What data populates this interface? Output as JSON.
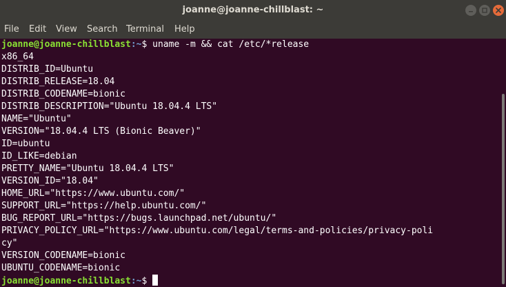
{
  "window": {
    "title": "joanne@joanne-chillblast: ~"
  },
  "menu": [
    "File",
    "Edit",
    "View",
    "Search",
    "Terminal",
    "Help"
  ],
  "prompt": {
    "user_host": "joanne@joanne-chillblast",
    "path": ":~",
    "symbol": "$ "
  },
  "terminal": {
    "command": "uname -m && cat /etc/*release",
    "output": [
      "x86_64",
      "DISTRIB_ID=Ubuntu",
      "DISTRIB_RELEASE=18.04",
      "DISTRIB_CODENAME=bionic",
      "DISTRIB_DESCRIPTION=\"Ubuntu 18.04.4 LTS\"",
      "NAME=\"Ubuntu\"",
      "VERSION=\"18.04.4 LTS (Bionic Beaver)\"",
      "ID=ubuntu",
      "ID_LIKE=debian",
      "PRETTY_NAME=\"Ubuntu 18.04.4 LTS\"",
      "VERSION_ID=\"18.04\"",
      "HOME_URL=\"https://www.ubuntu.com/\"",
      "SUPPORT_URL=\"https://help.ubuntu.com/\"",
      "BUG_REPORT_URL=\"https://bugs.launchpad.net/ubuntu/\"",
      "PRIVACY_POLICY_URL=\"https://www.ubuntu.com/legal/terms-and-policies/privacy-poli",
      "cy\"",
      "VERSION_CODENAME=bionic",
      "UBUNTU_CODENAME=bionic"
    ]
  },
  "colors": {
    "background": "#300a24",
    "titlebar": "#3c3b37",
    "prompt_user": "#8ae234",
    "prompt_path": "#729fcf",
    "close_button": "#e66b3a"
  },
  "icons": {
    "minimize": "minimize-icon",
    "maximize": "maximize-icon",
    "close": "close-icon"
  }
}
